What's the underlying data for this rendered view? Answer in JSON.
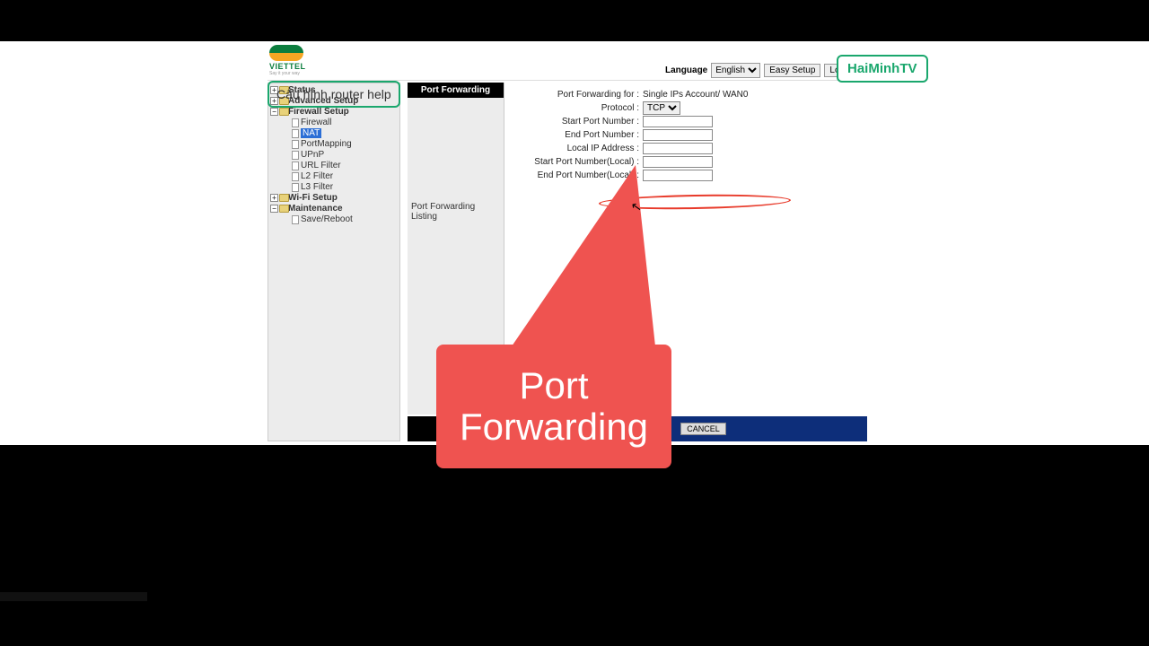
{
  "logo": {
    "brand": "VIETTEL",
    "tagline": "Say it your way"
  },
  "header": {
    "language_label": "Language",
    "language_value": "English",
    "easy_setup": "Easy Setup",
    "log_out": "Log Out"
  },
  "sidebar": {
    "status": "Status",
    "advanced": "Advanced Setup",
    "firewall_setup": "Firewall Setup",
    "firewall": "Firewall",
    "nat": "NAT",
    "portmapping": "PortMapping",
    "upnp": "UPnP",
    "url_filter": "URL Filter",
    "l2_filter": "L2 Filter",
    "l3_filter": "L3 Filter",
    "wifi": "Wi-Fi Setup",
    "maintenance": "Maintenance",
    "save_reboot": "Save/Reboot"
  },
  "panel": {
    "title": "Port Forwarding",
    "listing": "Port Forwarding Listing"
  },
  "form": {
    "for_label": "Port Forwarding for :",
    "for_value": "Single IPs Account/ WAN0",
    "protocol_label": "Protocol :",
    "protocol_value": "TCP",
    "start_port_label": "Start Port Number :",
    "end_port_label": "End Port Number :",
    "local_ip_label": "Local IP Address :",
    "start_port_local_label": "Start Port Number(Local) :",
    "end_port_local_label": "End Port Number(Local) :"
  },
  "buttons": {
    "cancel": "CANCEL"
  },
  "annotations": {
    "left": "Cấu hình router help",
    "right": "HaiMinhTV",
    "callout": "Port Forwarding"
  }
}
